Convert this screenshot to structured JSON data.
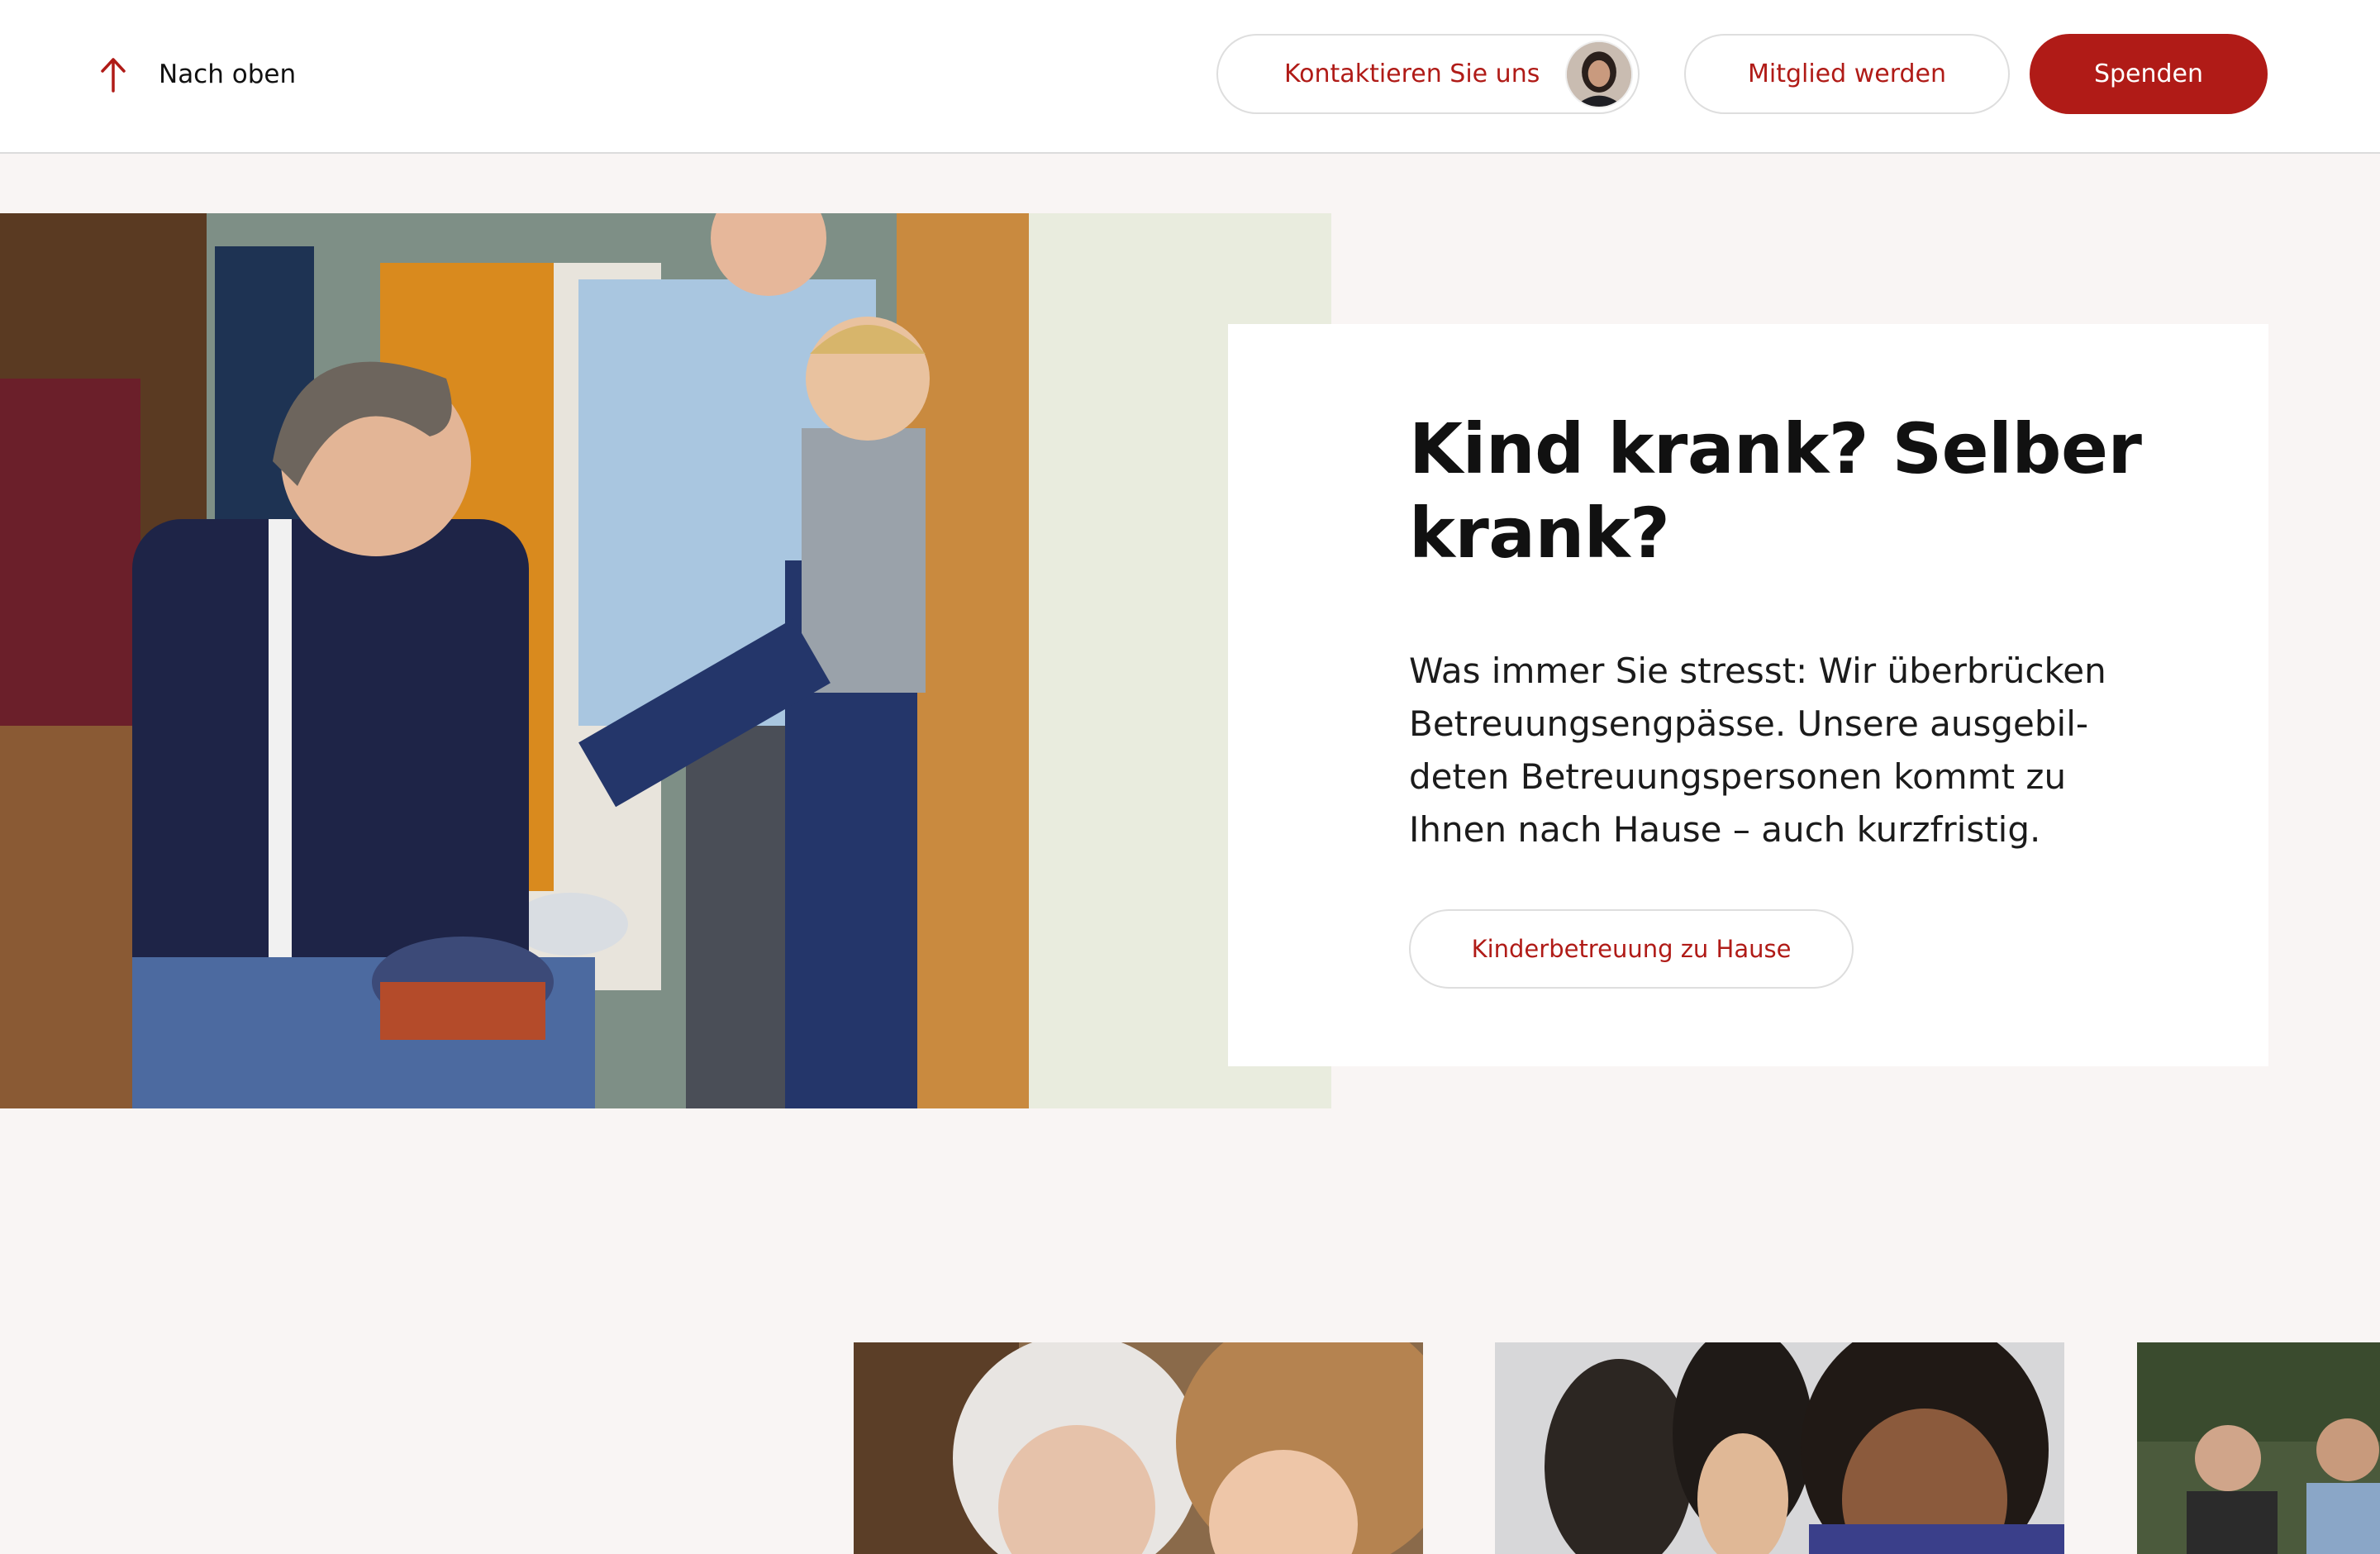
{
  "header": {
    "back_to_top": "Nach oben",
    "contact_label": "Kontaktieren Sie uns",
    "member_label": "Mitglied werden",
    "donate_label": "Spenden"
  },
  "hero": {
    "title": "Kind krank? Selber krank?",
    "text": "Was immer Sie stresst: Wir überbrücken Betreuungsengpässe. Unsere ausgebil­deten Betreuungspersonen kommt zu Ihnen nach Hause – auch kurzfristig.",
    "button_label": "Kinderbetreuung zu Hause"
  },
  "colors": {
    "brand_red": "#b01b17",
    "page_background": "#f9f5f4",
    "card_background": "#ffffff"
  },
  "icons": {
    "back_to_top": "arrow-up-icon"
  }
}
